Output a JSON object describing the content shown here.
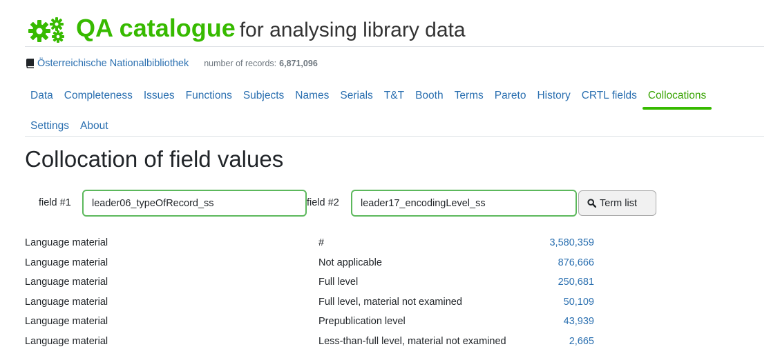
{
  "brand": {
    "title": "QA catalogue",
    "subtitle": "for analysing library data",
    "icon": "gears-icon",
    "accent_color": "#37ba00"
  },
  "library": {
    "name": "Österreichische Nationalbibliothek",
    "icon": "book-icon",
    "records_label": "number of records:",
    "records_count": "6,871,096"
  },
  "nav": {
    "row1": [
      {
        "label": "Data"
      },
      {
        "label": "Completeness"
      },
      {
        "label": "Issues"
      },
      {
        "label": "Functions"
      },
      {
        "label": "Subjects"
      },
      {
        "label": "Names"
      },
      {
        "label": "Serials"
      },
      {
        "label": "T&T"
      },
      {
        "label": "Booth"
      },
      {
        "label": "Terms"
      },
      {
        "label": "Pareto"
      },
      {
        "label": "History"
      },
      {
        "label": "CRTL fields"
      },
      {
        "label": "Collocations",
        "active": true
      }
    ],
    "row2": [
      {
        "label": "Settings"
      },
      {
        "label": "About"
      }
    ],
    "link_color": "#2a6fb0",
    "active_color": "#37a300"
  },
  "page": {
    "title": "Collocation of field values"
  },
  "form": {
    "field1_label": "field #1",
    "field1_value": "leader06_typeOfRecord_ss",
    "field2_label": "field #2",
    "field2_value": "leader17_encodingLevel_ss",
    "button_label": "Term list",
    "button_icon": "search-icon"
  },
  "results": [
    {
      "field1": "Language material",
      "field2": "#",
      "count": "3,580,359"
    },
    {
      "field1": "Language material",
      "field2": "Not applicable",
      "count": "876,666"
    },
    {
      "field1": "Language material",
      "field2": "Full level",
      "count": "250,681"
    },
    {
      "field1": "Language material",
      "field2": "Full level, material not examined",
      "count": "50,109"
    },
    {
      "field1": "Language material",
      "field2": "Prepublication level",
      "count": "43,939"
    },
    {
      "field1": "Language material",
      "field2": "Less-than-full level, material not examined",
      "count": "2,665"
    }
  ]
}
